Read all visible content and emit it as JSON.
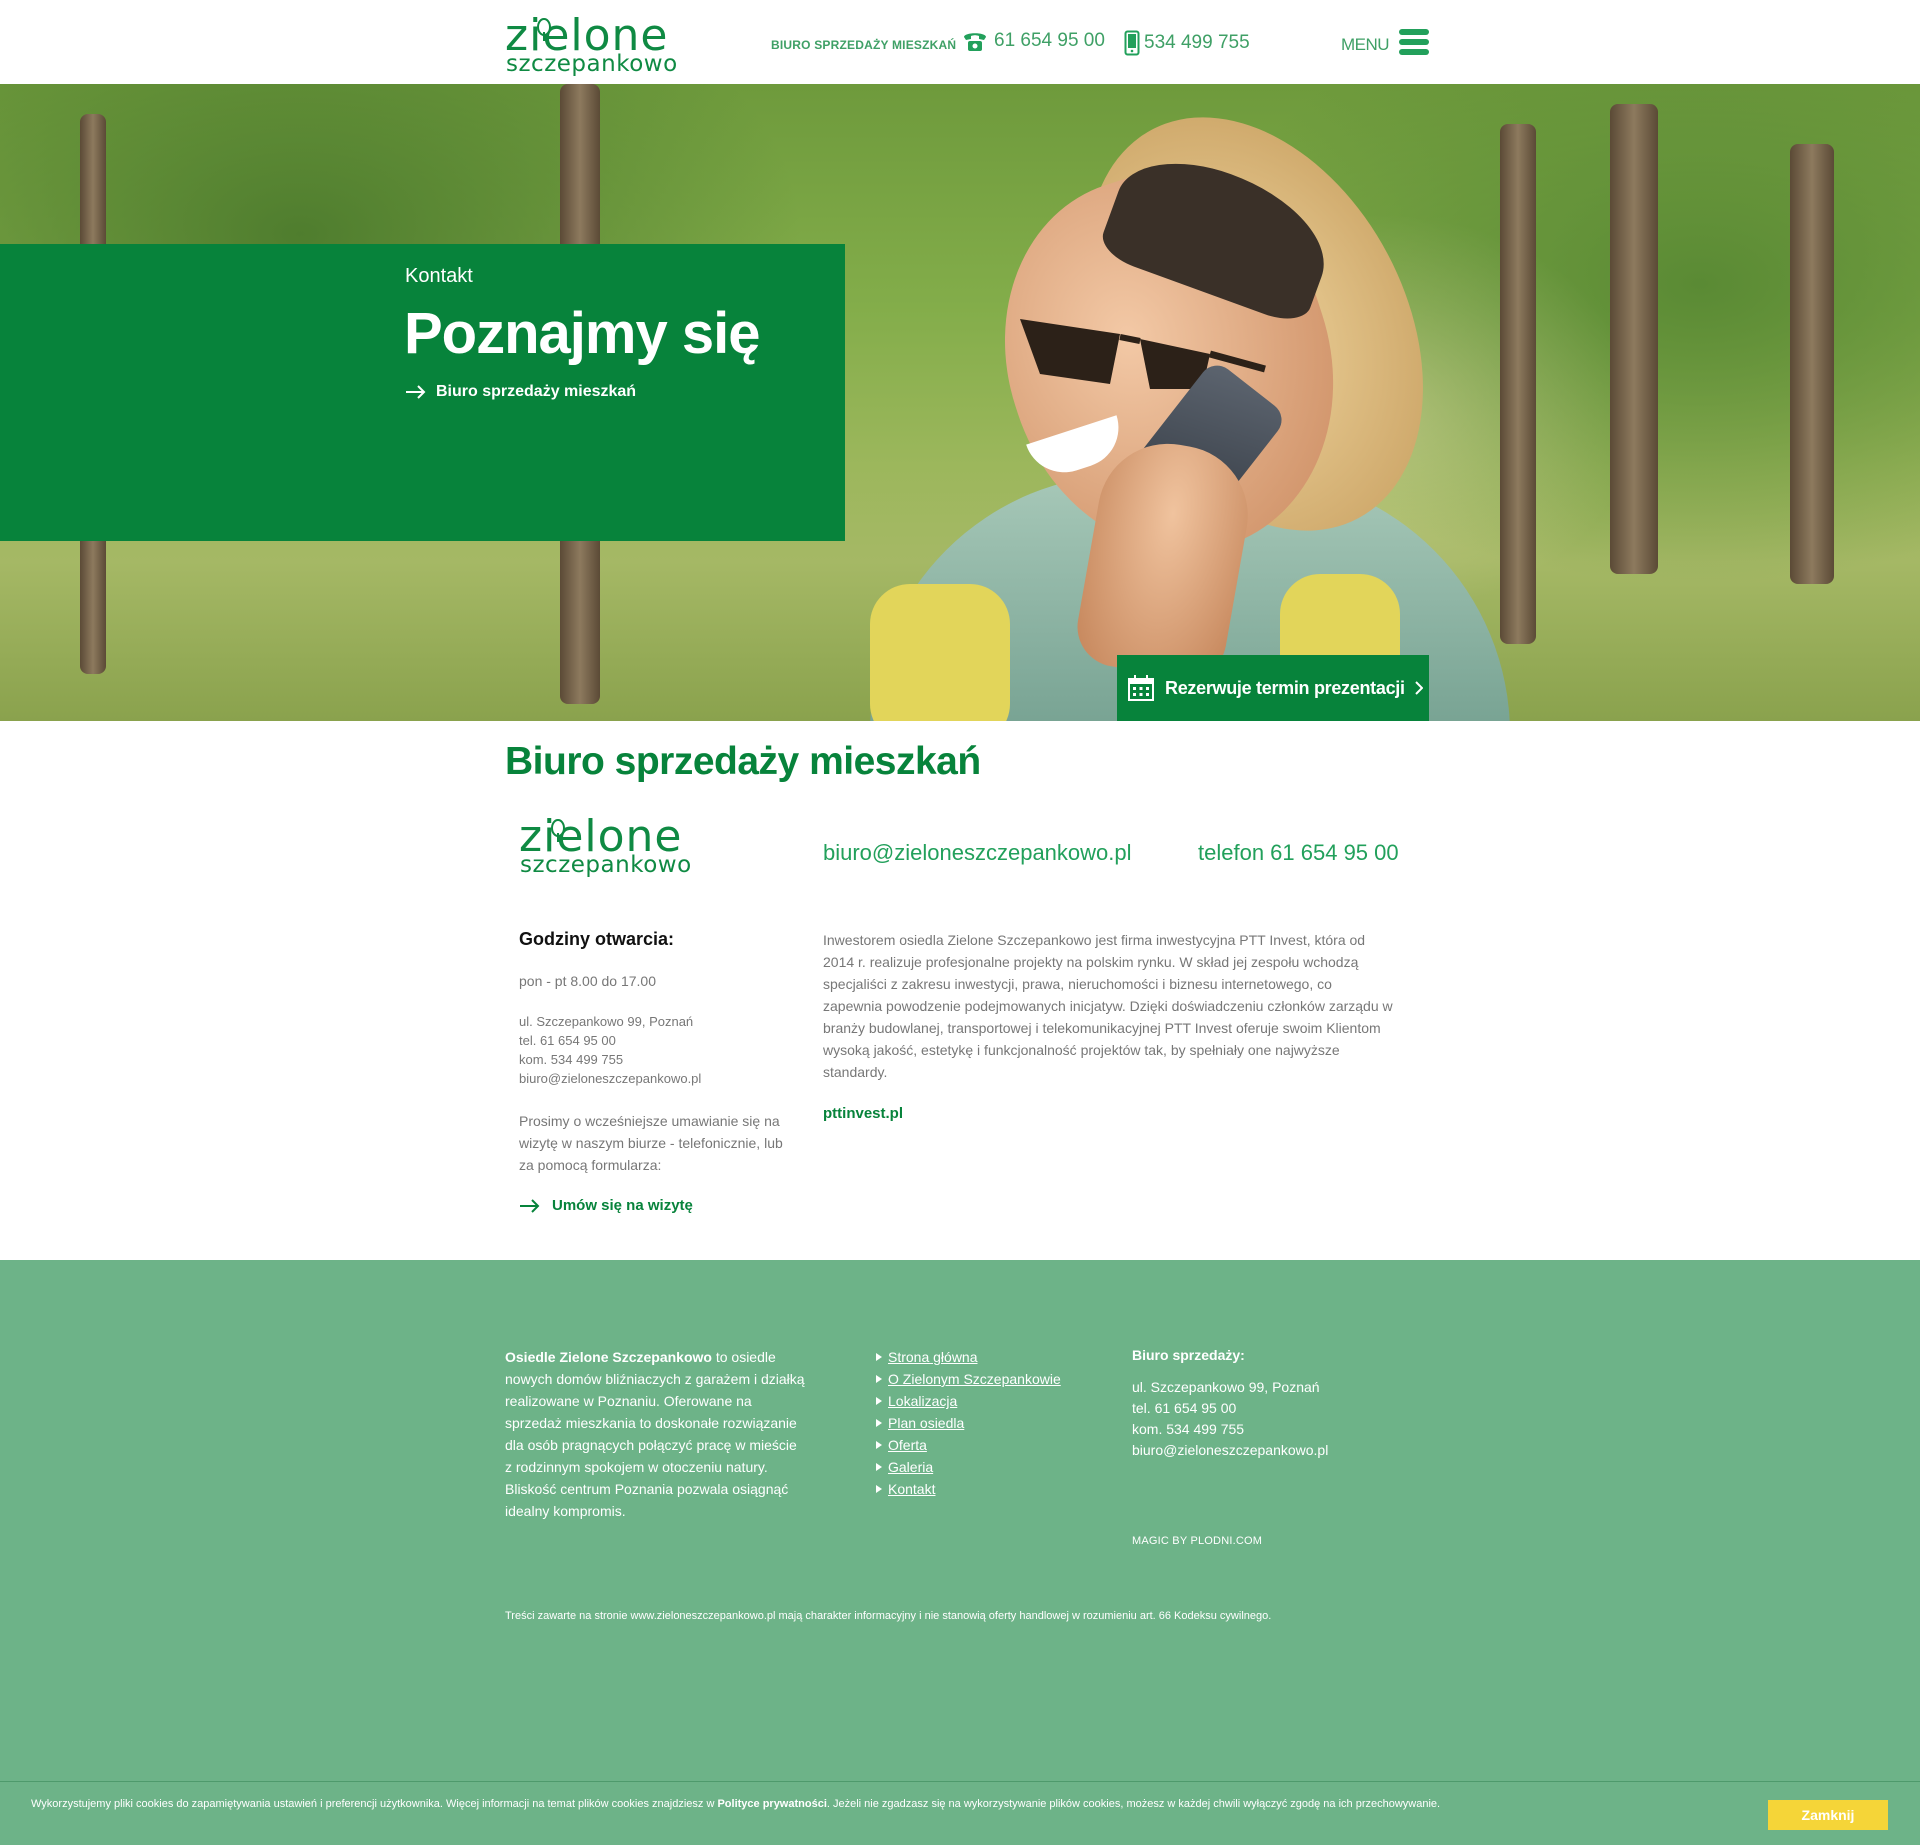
{
  "header": {
    "logo_line1": "zielone",
    "logo_line2": "szczepankowo",
    "office_label": "BIURO SPRZEDAŻY MIESZKAŃ",
    "phone1": "61 654 95 00",
    "phone2": "534 499 755",
    "menu_label": "MENU"
  },
  "hero": {
    "kicker": "Kontakt",
    "title": "Poznajmy się",
    "link": "Biuro sprzedaży mieszkań",
    "cta": "Rezerwuje termin prezentacji"
  },
  "office": {
    "title": "Biuro sprzedaży mieszkań",
    "logo_line1": "zielone",
    "logo_line2": "szczepankowo",
    "email": "biuro@zieloneszczepankowo.pl",
    "phone": "telefon 61 654 95 00",
    "hours_heading": "Godziny otwarcia:",
    "hours": "pon - pt 8.00 do 17.00",
    "address_lines": [
      "ul. Szczepankowo 99, Poznań",
      "tel. 61 654 95 00",
      "kom. 534 499 755",
      "biuro@zieloneszczepankowo.pl"
    ],
    "please": "Prosimy o wcześniejsze umawianie się na wizytę w naszym biurze - telefonicznie, lub za pomocą formularza:",
    "visit_link": "Umów się na wizytę",
    "about": "Inwestorem osiedla Zielone Szczepankowo jest firma inwestycyjna PTT Invest, która od 2014 r. realizuje profesjonalne projekty na polskim rynku. W skład jej zespołu wchodzą specjaliści z zakresu inwestycji, prawa, nieruchomości i biznesu internetowego, co zapewnia powodzenie podejmowanych inicjatyw. Dzięki doświadczeniu członków zarządu w branży budowlanej, transportowej i telekomunikacyjnej PTT Invest oferuje swoim Klientom wysoką jakość, estetykę i funkcjonalność projektów tak, by spełniały one najwyższe standardy.",
    "ptt_link": "pttinvest.pl"
  },
  "footer": {
    "about_bold": "Osiedle Zielone Szczepankowo",
    "about_rest": " to osiedle nowych domów bliźniaczych z garażem i działką realizowane w Poznaniu. Oferowane na sprzedaż mieszkania to doskonałe rozwiązanie dla osób pragnących połączyć pracę w mieście z rodzinnym spokojem w otoczeniu natury. Bliskość centrum Poznania pozwala osiągnąć idealny kompromis.",
    "nav": [
      "Strona główna",
      "O Zielonym Szczepankowie",
      "Lokalizacja",
      "Plan osiedla",
      "Oferta",
      "Galeria",
      "Kontakt"
    ],
    "office_heading": "Biuro sprzedaży:",
    "office_lines": [
      "ul. Szczepankowo 99, Poznań",
      "tel. 61 654 95 00",
      "kom. 534 499 755",
      "biuro@zieloneszczepankowo.pl"
    ],
    "magic": "MAGIC BY PLODNI.COM",
    "legal": "Treści zawarte na stronie www.zieloneszczepankowo.pl mają charakter informacyjny i nie stanowią oferty handlowej w rozumieniu art. 66 Kodeksu cywilnego."
  },
  "cookie": {
    "text_before": "Wykorzystujemy pliki cookies do zapamiętywania ustawień i preferencji użytkownika. Więcej informacji na temat plików cookies znajdziesz w ",
    "policy_link": "Polityce prywatności",
    "text_after": ". Jeżeli nie zgadzasz się na wykorzystywanie plików cookies, możesz w każdej chwili wyłączyć zgodę na ich przechowywanie.",
    "button": "Zamknij"
  },
  "colors": {
    "brand_green": "#07833b",
    "light_green": "#22a05b",
    "footer_green": "#6db388",
    "cookie_button": "#f5d538"
  },
  "icons": [
    "tree-logo-icon",
    "telephone-icon",
    "mobile-phone-icon",
    "hamburger-menu-icon",
    "arrow-right-icon",
    "calendar-icon",
    "chevron-right-icon",
    "triangle-bullet-icon"
  ]
}
